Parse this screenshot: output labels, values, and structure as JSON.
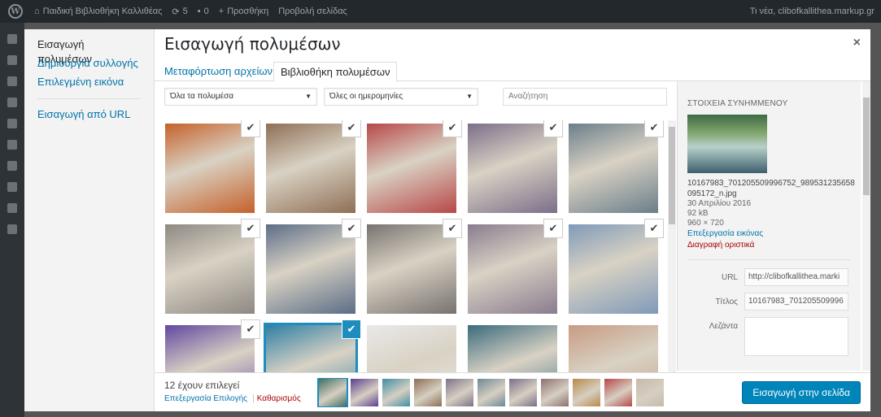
{
  "adminbar": {
    "site_name": "Παιδική Βιβλιοθήκη Καλλιθέας",
    "updates": "5",
    "comments": "0",
    "new_label": "Προσθήκη",
    "view_page": "Προβολή σελίδας",
    "greeting": "Τι νέα, clibofkallithea.markup.gr"
  },
  "menu": {
    "items": [
      {
        "label": "Εισαγωγή πολυμέσων"
      },
      {
        "label": "Δημιουργία συλλογής"
      },
      {
        "label": "Επιλεγμένη εικόνα"
      },
      {
        "label": "Εισαγωγή από URL"
      }
    ]
  },
  "modal": {
    "title": "Εισαγωγή πολυμέσων",
    "close": "×"
  },
  "tabs": [
    {
      "label": "Μεταφόρτωση αρχείων"
    },
    {
      "label": "Βιβλιοθήκη πολυμέσων"
    }
  ],
  "filters": {
    "type": "Όλα τα πολυμέσα",
    "date": "Όλες οι ημερομηνίες",
    "search_placeholder": "Αναζήτηση"
  },
  "grid": {
    "check_glyph": "✔",
    "colors": [
      "#c5612a",
      "#8e6f55",
      "#b74848",
      "#7a6f89",
      "#6b7e8a",
      "#8d8882",
      "#5b6d86",
      "#777270",
      "#8a7c8f",
      "#7f9ab8",
      "#6248a0",
      "#2f7fa4",
      "#e9e9e9",
      "#3a6b7d",
      "#c79b83"
    ]
  },
  "details": {
    "heading": "ΣΤΟΙΧΕΙΑ ΣΥΝΗΜΜΕΝΟΥ",
    "filename": "10167983_701205509996752_989531235658095172_n.jpg",
    "date": "30 Απριλίου 2016",
    "size": "92 kB",
    "dimensions": "960 × 720",
    "edit_image": "Επεξεργασία εικόνας",
    "delete": "Διαγραφή οριστικά",
    "url_label": "URL",
    "url_value": "http://clibofkallithea.marki",
    "title_label": "Τίτλος",
    "title_value": "10167983_701205509996",
    "caption_label": "Λεζάντα",
    "caption_value": ""
  },
  "footer": {
    "count": "12 έχουν επιλεγεί",
    "edit_selection": "Επεξεργασία Επιλογής",
    "clear": "Καθαρισμός",
    "insert": "Εισαγωγή στην σελίδα",
    "strip_colors": [
      "#3f6f61",
      "#5b3e90",
      "#3f8fa4",
      "#8e6e55",
      "#7c7385",
      "#6d8996",
      "#7a6f89",
      "#8e6f6f",
      "#b78a4a",
      "#b74848",
      "#c7b9a9"
    ]
  }
}
